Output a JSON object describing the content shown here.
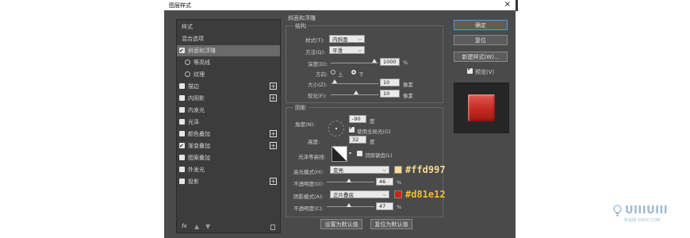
{
  "window": {
    "title": "图层样式",
    "close_glyph": "×"
  },
  "left_panel": {
    "items": [
      {
        "label": "样式",
        "control": "none",
        "selected": false
      },
      {
        "label": "混合选项",
        "control": "none",
        "selected": false
      },
      {
        "label": "斜面和浮雕",
        "control": "checkbox",
        "checked": true,
        "selected": true
      },
      {
        "label": "等高线",
        "control": "radio",
        "indent": true
      },
      {
        "label": "纹理",
        "control": "radio",
        "indent": true
      },
      {
        "label": "描边",
        "control": "checkbox",
        "checked": false,
        "plus": true
      },
      {
        "label": "内阴影",
        "control": "checkbox",
        "checked": false,
        "plus": true
      },
      {
        "label": "内发光",
        "control": "checkbox",
        "checked": false
      },
      {
        "label": "光泽",
        "control": "checkbox",
        "checked": false
      },
      {
        "label": "颜色叠加",
        "control": "checkbox",
        "checked": false,
        "plus": true
      },
      {
        "label": "渐变叠加",
        "control": "checkbox",
        "checked": true,
        "plus": true
      },
      {
        "label": "图案叠加",
        "control": "checkbox",
        "checked": false
      },
      {
        "label": "外发光",
        "control": "checkbox",
        "checked": false
      },
      {
        "label": "投影",
        "control": "checkbox",
        "checked": false,
        "plus": true
      }
    ],
    "footer_icons": [
      "fx-icon",
      "arrow-up-icon",
      "arrow-down-icon",
      "trash-icon"
    ],
    "fx_label": "fx"
  },
  "bevel": {
    "section_title": "斜面和浮雕",
    "structure_title": "结构",
    "style_label": "样式(T):",
    "style_value": "内斜面",
    "technique_label": "方法(Q):",
    "technique_value": "平滑",
    "depth_label": "深度(D):",
    "depth_value": "1000",
    "depth_unit": "%",
    "direction_label": "方向:",
    "dir_up": "上",
    "dir_down": "下",
    "size_label": "大小(Z):",
    "size_value": "10",
    "size_unit": "像素",
    "soften_label": "软化(F):",
    "soften_value": "10",
    "soften_unit": "像素"
  },
  "shading": {
    "title": "阴影",
    "angle_label": "角度(N):",
    "angle_value": "-90",
    "angle_unit": "度",
    "global_light_label": "使用全局光(G)",
    "altitude_label": "高度:",
    "altitude_value": "32",
    "altitude_unit": "度",
    "gloss_label": "光泽等高线:",
    "antialias_label": "消除锯齿(L)",
    "highlight_mode_label": "高光模式(H):",
    "highlight_mode_value": "变亮",
    "highlight_opacity_label": "不透明度(O):",
    "highlight_opacity_value": "46",
    "highlight_opacity_unit": "%",
    "shadow_mode_label": "阴影模式(A):",
    "shadow_mode_value": "正片叠底",
    "shadow_opacity_label": "不透明度(C):",
    "shadow_opacity_value": "47",
    "shadow_opacity_unit": "%",
    "highlight_color": "#ffd997",
    "shadow_color": "#d81e12"
  },
  "bottom_buttons": {
    "set_default": "设置为默认值",
    "reset_default": "复位为默认值"
  },
  "right_buttons": {
    "ok": "确定",
    "reset": "复位",
    "new_style": "新建样式(W)...",
    "preview": "预览(V)"
  },
  "annotations": {
    "highlight_hex": "#ffd997",
    "shadow_hex": "#d81e12",
    "highlight_text_color": "#f5d890",
    "shadow_text_color": "#f0c020"
  },
  "watermark": {
    "text": "UIIIUIII",
    "subtext": "优设网 UISDC.COM"
  }
}
